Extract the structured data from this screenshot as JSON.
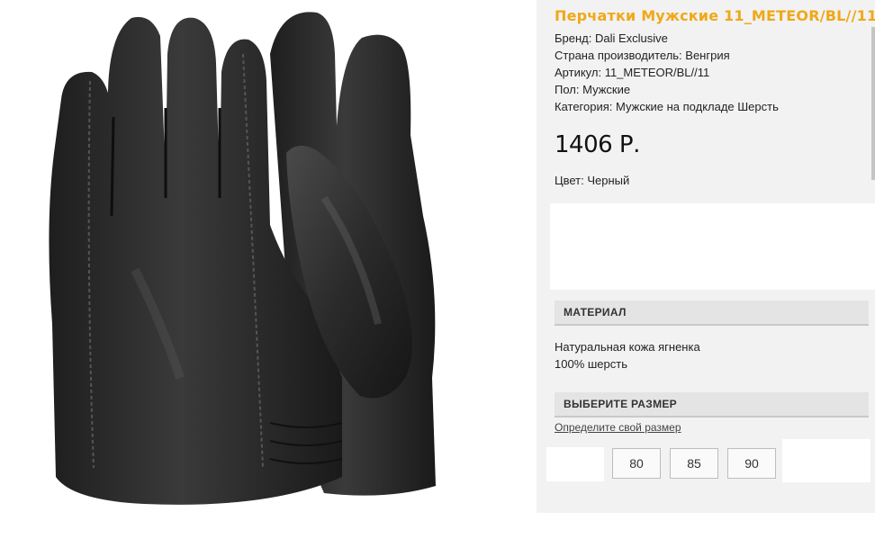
{
  "product": {
    "title": "Перчатки Мужские 11_METEOR/BL//11",
    "brand": "Бренд: Dali Exclusive",
    "country": "Страна производитель: Венгрия",
    "article": "Артикул: 11_METEOR/BL//11",
    "gender": "Пол: Мужские",
    "category": "Категория: Мужские на подкладе Шерсть",
    "price": "1406 Р.",
    "color": "Цвет: Черный"
  },
  "material": {
    "heading": "МАТЕРИАЛ",
    "lines": [
      "Натуральная кожа ягненка",
      "100% шерсть"
    ]
  },
  "size": {
    "heading": "ВЫБЕРИТЕ РАЗМЕР",
    "guide_link": "Определите свой размер",
    "options": [
      "80",
      "85",
      "90"
    ]
  },
  "colors": {
    "title": "#f0a818",
    "glove": "#2a2a2a",
    "panel": "#f2f2f2"
  }
}
